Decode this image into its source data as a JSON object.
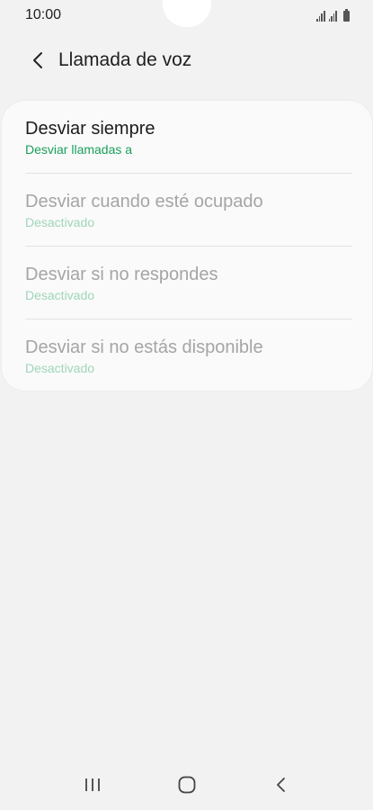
{
  "status_bar": {
    "time": "10:00",
    "icons": [
      "signal-icon",
      "signal-icon",
      "battery-icon"
    ]
  },
  "header": {
    "title": "Llamada de voz",
    "back_icon": "back-arrow-icon"
  },
  "settings": {
    "items": [
      {
        "label": "Desviar siempre",
        "value": "Desviar llamadas a",
        "enabled": true
      },
      {
        "label": "Desviar cuando esté ocupado",
        "value": "Desactivado",
        "enabled": false
      },
      {
        "label": "Desviar si no respondes",
        "value": "Desactivado",
        "enabled": false
      },
      {
        "label": "Desviar si no estás disponible",
        "value": "Desactivado",
        "enabled": false
      }
    ]
  },
  "nav_bar": {
    "buttons": [
      "recents-icon",
      "home-icon",
      "back-icon"
    ]
  },
  "colors": {
    "background": "#f2f2f2",
    "card": "#fafafa",
    "accent_green": "#1a9f5c",
    "disabled_text": "#a5a5a5"
  }
}
